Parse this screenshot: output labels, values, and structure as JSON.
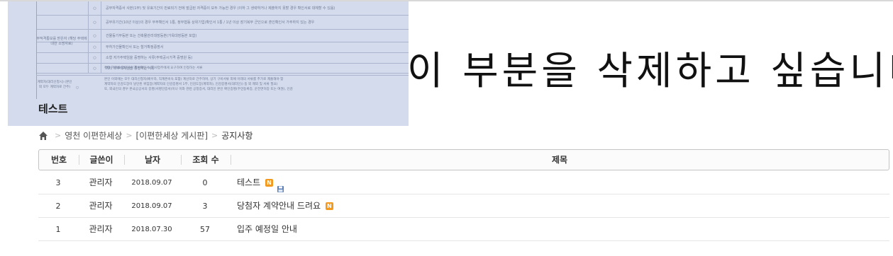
{
  "overlay": {
    "rows": [
      {
        "mark": "○",
        "text": "공부자격증서 사본(1부) 및 유효기간이 만료되기 전에 발급된 자격증이 모두 가능한 경우 (이하 그 생략하거나 제출하지 못할 경우 확인서로 대체할 수 있음)"
      },
      {
        "mark": "○",
        "text": "공부유기간(10년 이상)의 경우 부부확인서 1통, 정부협동 상위기업(확인서 1통 / 1년 이상 장기복무 군인으로 혼인확인서 가주하지 있는 경우"
      },
      {
        "mark": "○",
        "text": "건물등기부등본 또는 건축물관리대장등본(가옥대장등본 포함)"
      },
      {
        "mark": "○",
        "text": "무허가건물확인서 또는 철거확정증명서"
      },
      {
        "mark": "○",
        "text": "소형 저가주택임을 증명하는 서류(주택공시가격 증명원 등)"
      },
      {
        "mark": "○",
        "text": "기타 무주택자임을 증명하는 서류"
      },
      {
        "mark": "○",
        "text": "취업 기관의 업당사실 확인확인서 중 사업주에게 요구하여 인정하는 서류"
      }
    ],
    "side_label": "부적격통보를 받은자 (해당 주택에 대한 소명자료)",
    "bottom_left": "계약자(대리신청시) (본인 외 모두 계약자로 간주)",
    "bottom_mark": "○",
    "bottom_lines": [
      "본인 이외에는 모두 대리신청자(배우자, 직계존비속 포함) 계산자로 간주하며, 상기 구비서류 외에 아래의 서류를 추가로 제출해야 함",
      "계약자의 인감도장이 날인된 위임장(계약자의 인감증명서 1부, 인감도장(계약자), 인감증명서(대리인)) 등 외 제외 및 서류 필요)",
      "또, 외국인의 경우 본국공공서의 증명(서명인증서)이나 이와 관련 공정증서, 대리인 본인 확인증명(주민등록증, 운전면허증 또는 여권), 인감"
    ],
    "title": "테스트"
  },
  "annotation": "이 부분을 삭제하고 싶습니다",
  "breadcrumb": {
    "items": [
      "영천 이편한세상",
      "[이편한세상 게시판]"
    ],
    "current": "공지사항"
  },
  "table": {
    "headers": {
      "num": "번호",
      "writer": "글쓴이",
      "date": "날자",
      "views": "조회 수",
      "subject": "제목"
    },
    "rows": [
      {
        "num": "3",
        "writer": "관리자",
        "date": "2018.09.07",
        "views": "0",
        "subject": "테스트",
        "new": true,
        "file": true
      },
      {
        "num": "2",
        "writer": "관리자",
        "date": "2018.09.07",
        "views": "3",
        "subject": "당첨자 계약안내 드려요",
        "new": true,
        "file": false
      },
      {
        "num": "1",
        "writer": "관리자",
        "date": "2018.07.30",
        "views": "57",
        "subject": "입주 예정일 안내",
        "new": false,
        "file": false
      }
    ]
  },
  "icons": {
    "new_label": "N",
    "home": "home-icon",
    "chevron": "chevron-right-icon",
    "file": "file-icon"
  },
  "colors": {
    "overlay_bg": "#d3dbec",
    "new_badge": "#f39a1e"
  }
}
